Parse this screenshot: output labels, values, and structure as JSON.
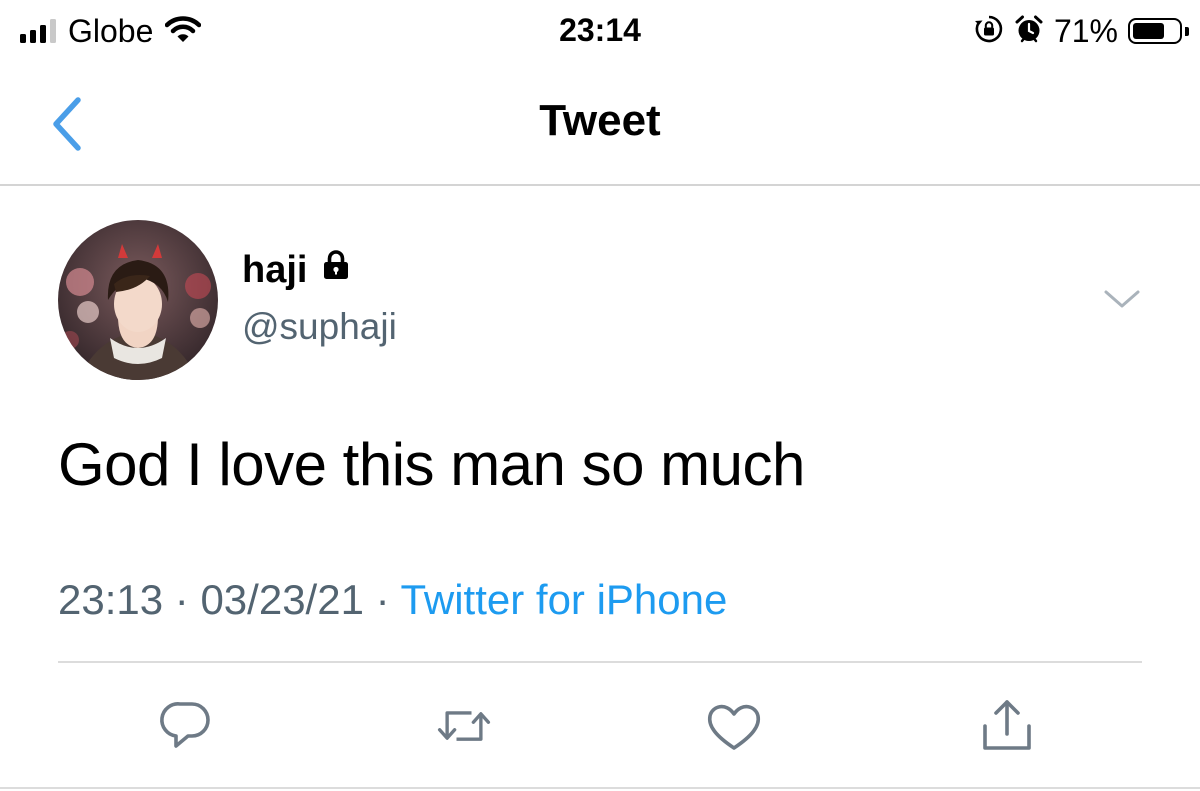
{
  "status_bar": {
    "carrier": "Globe",
    "time": "23:14",
    "battery_percent": "71%",
    "battery_level": 0.71,
    "signal_bars": 3,
    "icons": [
      "signal-icon",
      "wifi-icon",
      "orientation-lock-icon",
      "alarm-icon",
      "battery-icon"
    ]
  },
  "nav": {
    "title": "Tweet",
    "back_icon": "chevron-left-icon"
  },
  "tweet": {
    "display_name": "haji",
    "protected_icon": "lock-icon",
    "handle": "@suphaji",
    "text": "God I love this man so much",
    "time": "23:13",
    "separator_1": "·",
    "date": "03/23/21",
    "separator_2": "·",
    "source": "Twitter for iPhone",
    "menu_icon": "chevron-down-icon"
  },
  "actions": [
    {
      "name": "reply",
      "icon": "reply-icon"
    },
    {
      "name": "retweet",
      "icon": "retweet-icon"
    },
    {
      "name": "like",
      "icon": "heart-icon"
    },
    {
      "name": "share",
      "icon": "share-icon"
    }
  ],
  "colors": {
    "accent": "#1d9bf0",
    "back_chevron": "#4a9ee8",
    "secondary_text": "#536471",
    "action_icon": "#6e7a86",
    "divider": "#dcdcdc"
  }
}
